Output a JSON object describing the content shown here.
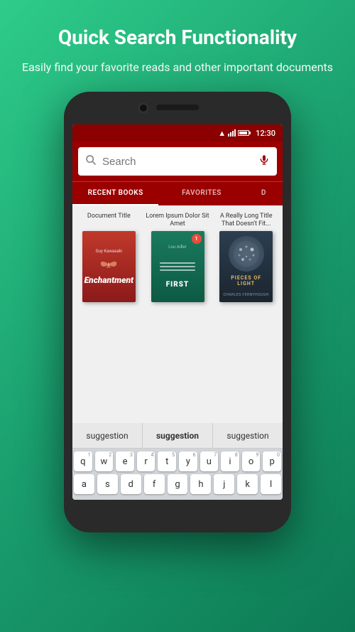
{
  "header": {
    "title": "Quick Search Functionality",
    "subtitle": "Easily find your favorite reads and other important documents"
  },
  "status_bar": {
    "time": "12:30"
  },
  "search": {
    "placeholder": "Search"
  },
  "tabs": [
    {
      "label": "RECENT BOOKS",
      "active": true
    },
    {
      "label": "FAVORITES",
      "active": false
    },
    {
      "label": "D",
      "active": false,
      "partial": true
    }
  ],
  "books": [
    {
      "title": "Document Title",
      "author": "Guy Kawasaki",
      "book_name": "Enchantment",
      "cover_type": "red"
    },
    {
      "title": "Lorem Ipsum Dolor Sit Amet",
      "author": "Lou Adler",
      "book_name": "FIRST",
      "cover_type": "green",
      "badge": "1"
    },
    {
      "title": "A Really Long Title That Doesn't Fit...",
      "author": "PIECES OF LIGHT",
      "book_name": "",
      "cover_type": "dark"
    }
  ],
  "suggestions": [
    {
      "label": "suggestion",
      "bold": false
    },
    {
      "label": "suggestion",
      "bold": true
    },
    {
      "label": "suggestion",
      "bold": false
    }
  ],
  "keyboard": {
    "rows": [
      [
        {
          "key": "q",
          "num": "1"
        },
        {
          "key": "w",
          "num": "2"
        },
        {
          "key": "e",
          "num": "3"
        },
        {
          "key": "r",
          "num": "4"
        },
        {
          "key": "t",
          "num": "5"
        },
        {
          "key": "y",
          "num": "6"
        },
        {
          "key": "u",
          "num": "7"
        },
        {
          "key": "i",
          "num": "8"
        },
        {
          "key": "o",
          "num": "9"
        },
        {
          "key": "p",
          "num": "0"
        }
      ],
      [
        {
          "key": "a",
          "num": ""
        },
        {
          "key": "s",
          "num": ""
        },
        {
          "key": "d",
          "num": ""
        },
        {
          "key": "f",
          "num": ""
        },
        {
          "key": "g",
          "num": ""
        },
        {
          "key": "h",
          "num": ""
        },
        {
          "key": "j",
          "num": ""
        },
        {
          "key": "k",
          "num": ""
        },
        {
          "key": "l",
          "num": ""
        }
      ]
    ]
  }
}
